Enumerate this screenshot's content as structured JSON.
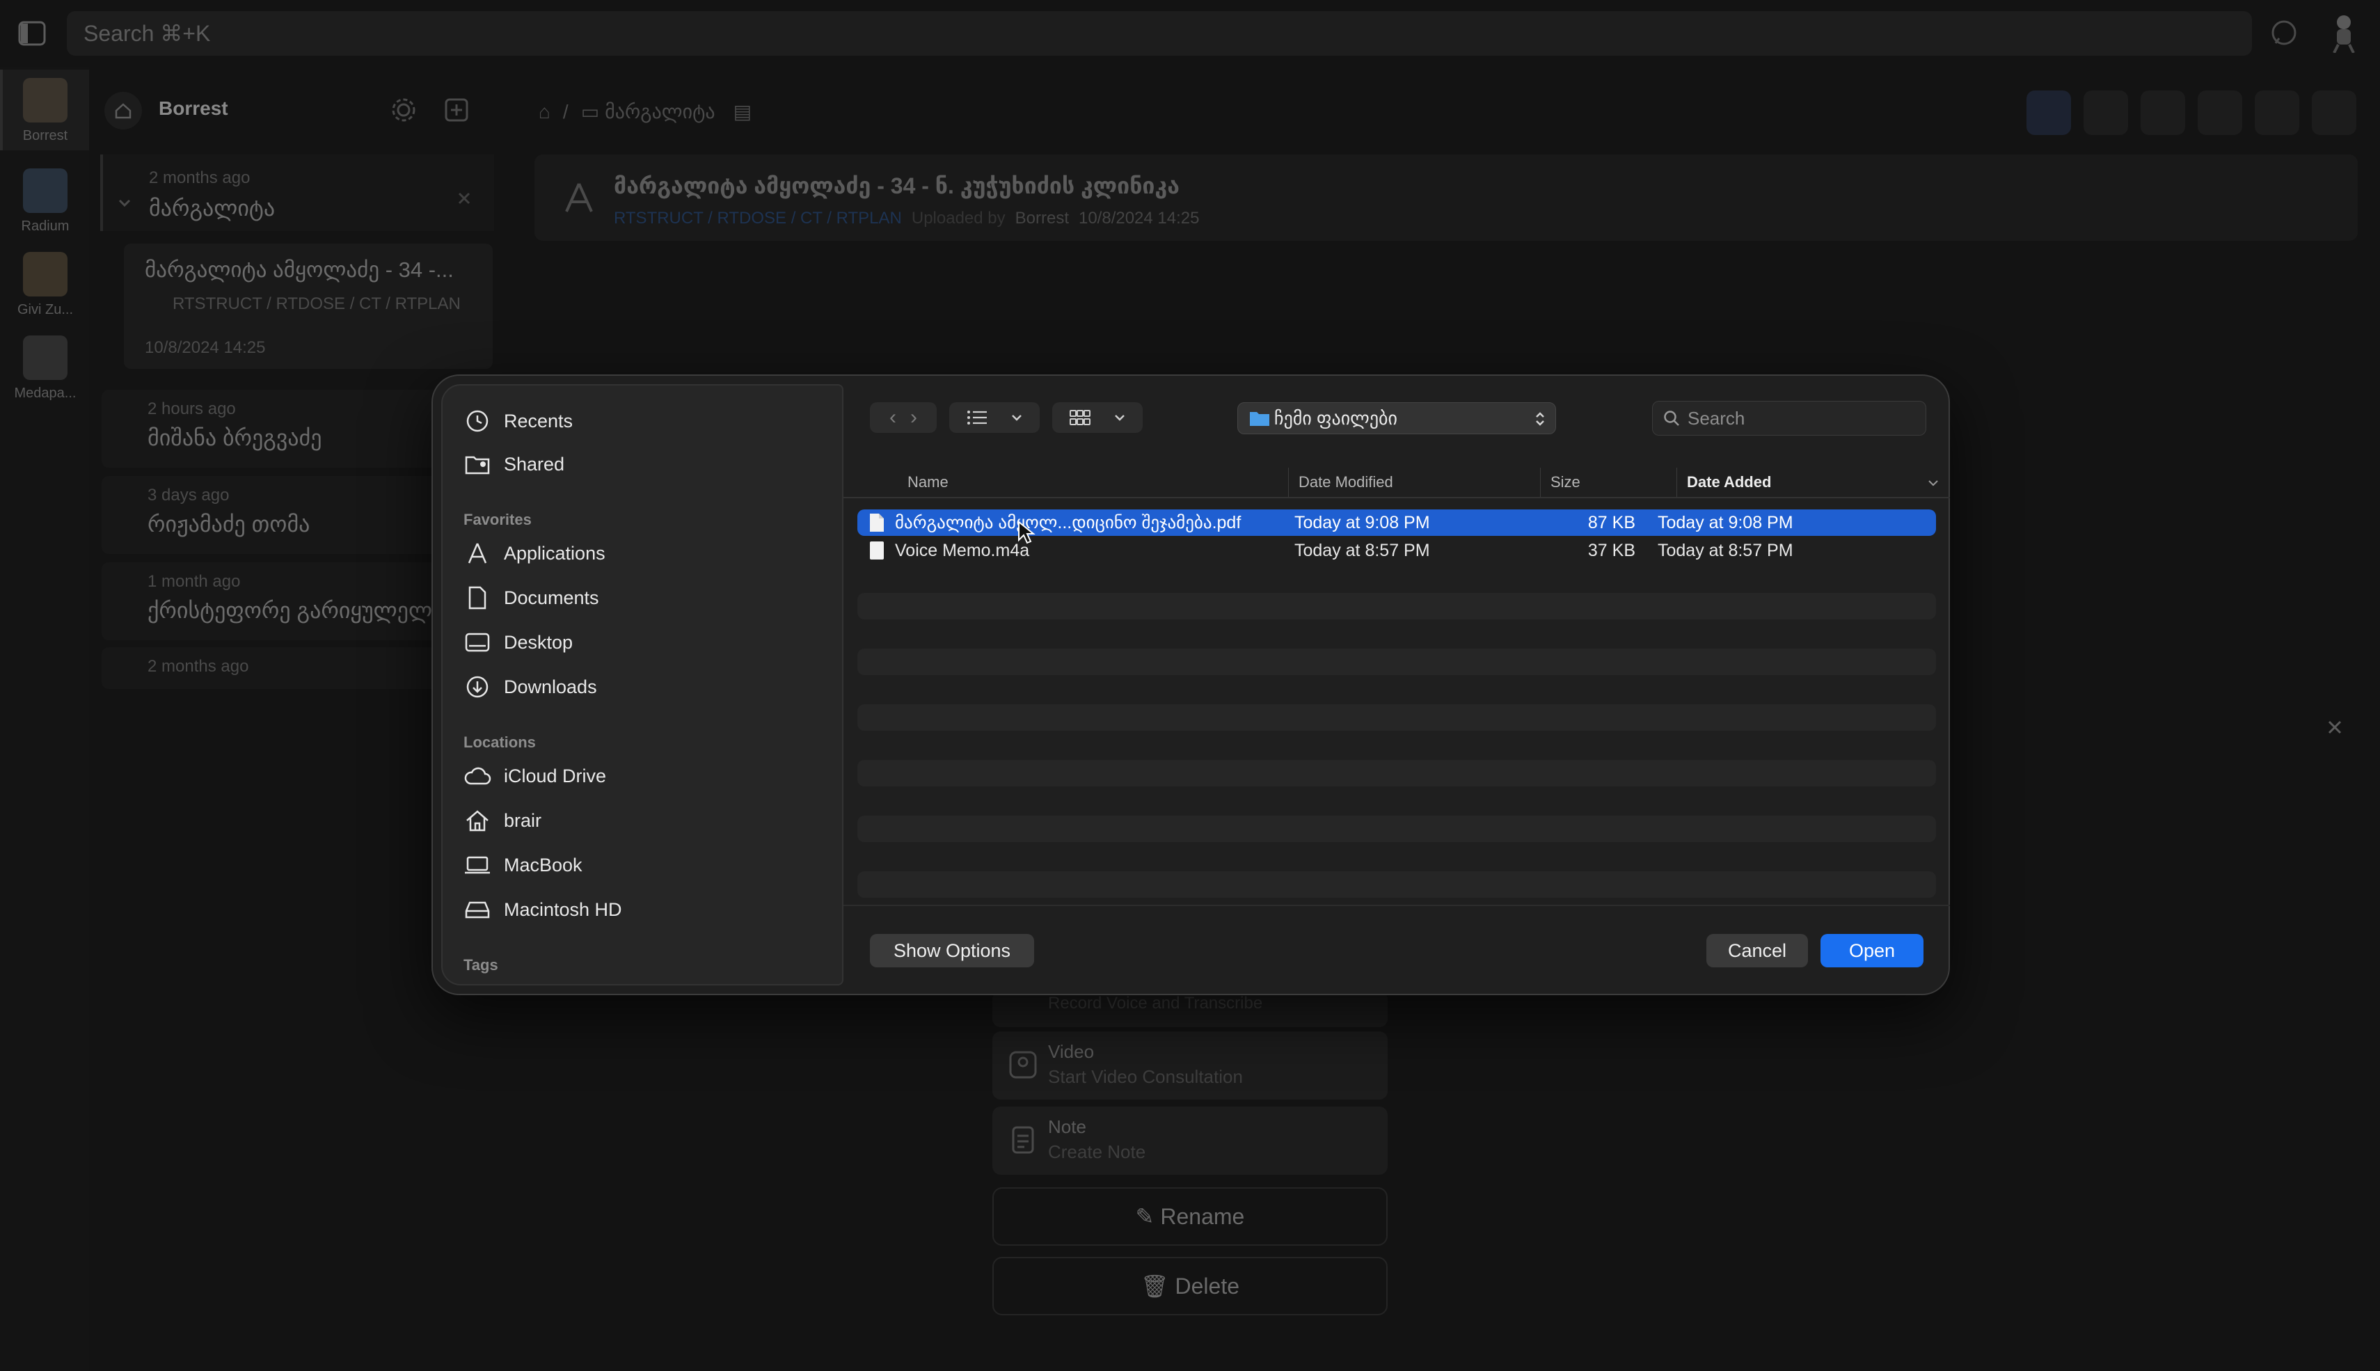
{
  "app": {
    "search_placeholder": "Search ⌘+K",
    "rail": [
      {
        "label": "Borrest"
      },
      {
        "label": "Radium"
      },
      {
        "label": "Givi Zu..."
      },
      {
        "label": "Medapa..."
      }
    ],
    "workspace": {
      "name": "Borrest"
    },
    "folder": {
      "time": "2 months ago",
      "name": "მარგალიტა",
      "card_title": "მარგალიტა ამყოლაძე - 34 -...",
      "card_tags": "RTSTRUCT / RTDOSE / CT / RTPLAN",
      "card_date": "10/8/2024 14:25"
    },
    "list": [
      {
        "time": "2 hours ago",
        "name": "მიშანა ბრეგვაძე"
      },
      {
        "time": "3 days ago",
        "name": "რიჟამაძე თომა"
      },
      {
        "time": "1 month ago",
        "name": "ქრისტეფორე გარიყულელ"
      },
      {
        "time": "2 months ago",
        "name": ""
      }
    ],
    "breadcrumb": {
      "folder": "მარგალიტა"
    },
    "header": {
      "title": "მარგალიტა ამყოლაძე - 34 - ნ. კუჭუხიძის კლინიკა",
      "tags": "RTSTRUCT / RTDOSE / CT / RTPLAN",
      "uploaded_by_label": "Uploaded by",
      "user": "Borrest",
      "date": "10/8/2024 14:25"
    },
    "actions": {
      "voice_sub": "Record Voice and Transcribe",
      "video_title": "Video",
      "video_sub": "Start Video Consultation",
      "note_title": "Note",
      "note_sub": "Create Note",
      "rename": "Rename",
      "delete": "Delete"
    }
  },
  "dialog": {
    "sidebar": {
      "top": [
        {
          "label": "Recents",
          "icon": "clock-icon"
        },
        {
          "label": "Shared",
          "icon": "shared-folder-icon"
        }
      ],
      "favorites_label": "Favorites",
      "favorites": [
        {
          "label": "Applications",
          "icon": "applications-icon"
        },
        {
          "label": "Documents",
          "icon": "document-icon"
        },
        {
          "label": "Desktop",
          "icon": "desktop-icon"
        },
        {
          "label": "Downloads",
          "icon": "download-icon"
        }
      ],
      "locations_label": "Locations",
      "locations": [
        {
          "label": "iCloud Drive",
          "icon": "cloud-icon"
        },
        {
          "label": "brair",
          "icon": "home-icon"
        },
        {
          "label": "MacBook",
          "icon": "laptop-icon"
        },
        {
          "label": "Macintosh HD",
          "icon": "drive-icon"
        }
      ],
      "tags_label": "Tags"
    },
    "location": "ჩემი ფაილები",
    "search_placeholder": "Search",
    "columns": {
      "name": "Name",
      "modified": "Date Modified",
      "size": "Size",
      "added": "Date Added"
    },
    "files": [
      {
        "name": "მარგალიტა ამყოლ...დიცინო შეჯამება.pdf",
        "modified": "Today at 9:08 PM",
        "size": "87 KB",
        "added": "Today at 9:08 PM",
        "selected": true
      },
      {
        "name": "Voice Memo.m4a",
        "modified": "Today at 8:57 PM",
        "size": "37 KB",
        "added": "Today at 8:57 PM",
        "selected": false
      }
    ],
    "buttons": {
      "options": "Show Options",
      "cancel": "Cancel",
      "open": "Open"
    }
  }
}
